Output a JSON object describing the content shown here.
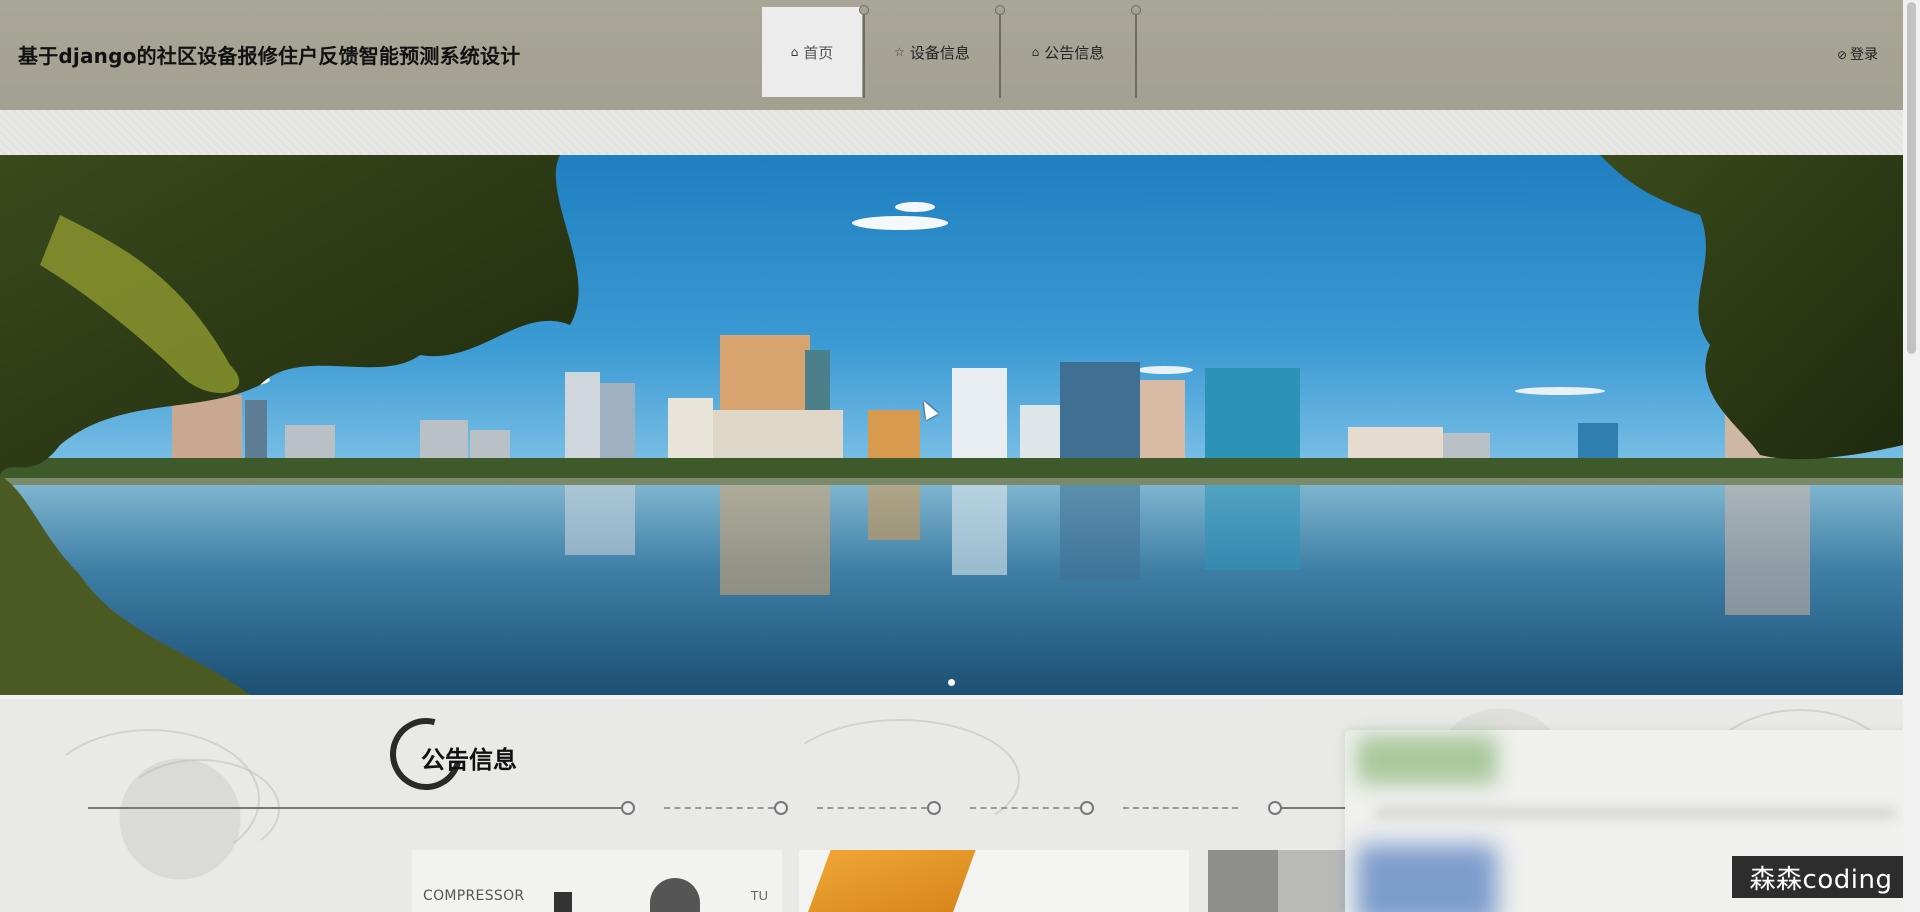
{
  "header": {
    "site_title": "基于django的社区设备报修住户反馈智能预测系统设计",
    "nav": [
      {
        "label": "首页",
        "icon": "home-icon",
        "active": true
      },
      {
        "label": "设备信息",
        "icon": "star-icon",
        "active": false
      },
      {
        "label": "公告信息",
        "icon": "bag-icon",
        "active": false
      }
    ],
    "login_label": "登录",
    "login_icon": "check-circle-icon"
  },
  "banner": {
    "slides_count": 1,
    "active_slide": 1
  },
  "section": {
    "title": "公告信息"
  },
  "cards": [
    {
      "text_left": "COMPRESSOR",
      "text_right": "TU"
    },
    {},
    {}
  ],
  "watermark": {
    "text": "森森coding"
  },
  "colors": {
    "header_bg": "#a6a395",
    "active_nav_bg": "#ececec",
    "page_bg": "#e6e6e4",
    "sky": "#2f8fce"
  }
}
